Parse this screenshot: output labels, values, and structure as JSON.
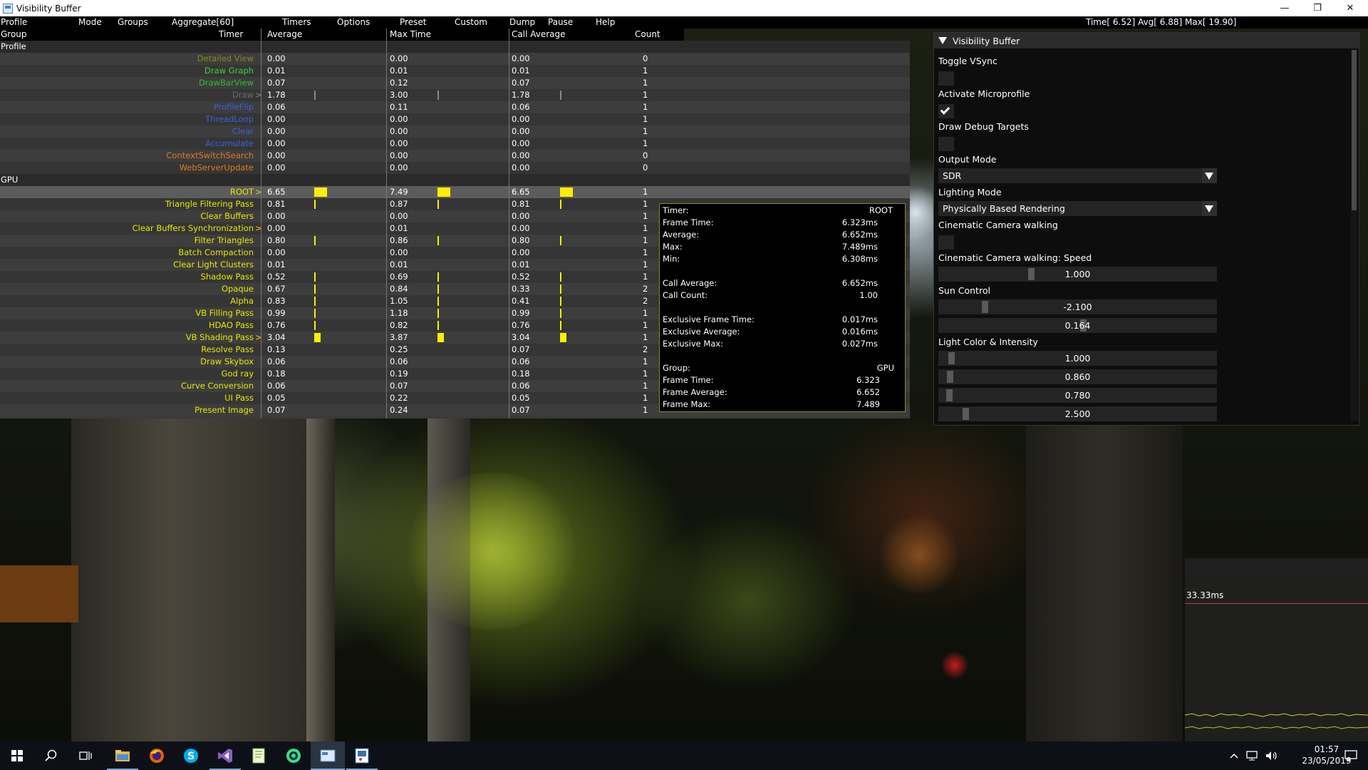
{
  "window": {
    "title": "Visibility Buffer"
  },
  "menu": [
    "Profile",
    "Mode",
    "Groups",
    "Aggregate[60]",
    "Timers",
    "Options",
    "Preset",
    "Custom",
    "Dump",
    "Pause",
    "Help"
  ],
  "stats": "Time[  6.52] Avg[  6.88] Max[ 19.90]",
  "columns": {
    "group": "Group",
    "timer": "Timer",
    "average": "Average",
    "max_time": "Max Time",
    "call_average": "Call Average",
    "count": "Count"
  },
  "sections": {
    "profile": "Profile",
    "gpu": "GPU"
  },
  "profile_rows": [
    {
      "name": "Detailed View",
      "color": "#8a8a1e",
      "avg": "0.00",
      "max": "0.00",
      "call": "0.00",
      "count": "0"
    },
    {
      "name": "Draw Graph",
      "color": "#3ed13e",
      "avg": "0.01",
      "max": "0.01",
      "call": "0.01",
      "count": "1"
    },
    {
      "name": "DrawBarView",
      "color": "#2fbf2f",
      "avg": "0.07",
      "max": "0.12",
      "call": "0.07",
      "count": "1"
    },
    {
      "name": "Draw",
      "color": "#6e6e6e",
      "avg": "1.78",
      "max": "3.00",
      "call": "1.78",
      "count": "1",
      "arrow": true,
      "ticks": "grey"
    },
    {
      "name": "ProfileFlip",
      "color": "#3b5fe0",
      "avg": "0.06",
      "max": "0.11",
      "call": "0.06",
      "count": "1"
    },
    {
      "name": "ThreadLoop",
      "color": "#3b5fe0",
      "avg": "0.00",
      "max": "0.00",
      "call": "0.00",
      "count": "1"
    },
    {
      "name": "Clear",
      "color": "#3b5fe0",
      "avg": "0.00",
      "max": "0.00",
      "call": "0.00",
      "count": "1"
    },
    {
      "name": "Accumulate",
      "color": "#3b5fe0",
      "avg": "0.00",
      "max": "0.00",
      "call": "0.00",
      "count": "1"
    },
    {
      "name": "ContextSwitchSearch",
      "color": "#e07a1e",
      "avg": "0.00",
      "max": "0.00",
      "call": "0.00",
      "count": "0"
    },
    {
      "name": "WebServerUpdate",
      "color": "#e07a1e",
      "avg": "0.00",
      "max": "0.00",
      "call": "0.00",
      "count": "0"
    }
  ],
  "gpu_rows": [
    {
      "name": "ROOT",
      "avg": "6.65",
      "max": "7.49",
      "call": "6.65",
      "count": "1",
      "arrow": true,
      "bar": "big",
      "hl": true
    },
    {
      "name": "Triangle Filtering Pass",
      "avg": "0.81",
      "max": "0.87",
      "call": "0.81",
      "count": "1",
      "ticks": "y"
    },
    {
      "name": "Clear Buffers",
      "avg": "0.00",
      "max": "0.00",
      "call": "0.00",
      "count": "1"
    },
    {
      "name": "Clear Buffers Synchronization",
      "avg": "0.00",
      "max": "0.01",
      "call": "0.00",
      "count": "1",
      "arrow": true
    },
    {
      "name": "Filter Triangles",
      "avg": "0.80",
      "max": "0.86",
      "call": "0.80",
      "count": "1",
      "ticks": "y"
    },
    {
      "name": "Batch Compaction",
      "avg": "0.00",
      "max": "0.00",
      "call": "0.00",
      "count": "1"
    },
    {
      "name": "Clear Light Clusters",
      "avg": "0.01",
      "max": "0.01",
      "call": "0.01",
      "count": "1"
    },
    {
      "name": "Shadow Pass",
      "avg": "0.52",
      "max": "0.69",
      "call": "0.52",
      "count": "1",
      "ticks": "y"
    },
    {
      "name": "Opaque",
      "avg": "0.67",
      "max": "0.84",
      "call": "0.33",
      "count": "2",
      "ticks": "y"
    },
    {
      "name": "Alpha",
      "avg": "0.83",
      "max": "1.05",
      "call": "0.41",
      "count": "2",
      "ticks": "y"
    },
    {
      "name": "VB Filling Pass",
      "avg": "0.99",
      "max": "1.18",
      "call": "0.99",
      "count": "1",
      "ticks": "y"
    },
    {
      "name": "HDAO Pass",
      "avg": "0.76",
      "max": "0.82",
      "call": "0.76",
      "count": "1",
      "ticks": "y"
    },
    {
      "name": "VB Shading Pass",
      "avg": "3.04",
      "max": "3.87",
      "call": "3.04",
      "count": "1",
      "arrow": true,
      "bar": "mid"
    },
    {
      "name": "Resolve Pass",
      "avg": "0.13",
      "max": "0.25",
      "call": "0.07",
      "count": "2"
    },
    {
      "name": "Draw Skybox",
      "avg": "0.06",
      "max": "0.06",
      "call": "0.06",
      "count": "1"
    },
    {
      "name": "God ray",
      "avg": "0.18",
      "max": "0.19",
      "call": "0.18",
      "count": "1"
    },
    {
      "name": "Curve Conversion",
      "avg": "0.06",
      "max": "0.07",
      "call": "0.06",
      "count": "1"
    },
    {
      "name": "UI Pass",
      "avg": "0.05",
      "max": "0.22",
      "call": "0.05",
      "count": "1"
    },
    {
      "name": "Present Image",
      "avg": "0.07",
      "max": "0.24",
      "call": "0.07",
      "count": "1"
    }
  ],
  "tooltip": {
    "timer_label": "Timer:",
    "timer_value": "ROOT",
    "lines": [
      {
        "k": "Frame Time:",
        "v": "6.323ms"
      },
      {
        "k": "Average:",
        "v": "6.652ms"
      },
      {
        "k": "Max:",
        "v": "7.489ms"
      },
      {
        "k": "Min:",
        "v": "6.308ms"
      },
      {
        "k": "Call Average:",
        "v": "6.652ms"
      },
      {
        "k": "Call Count:",
        "v": "1.00"
      },
      {
        "k": "Exclusive Frame Time:",
        "v": "0.017ms"
      },
      {
        "k": "Exclusive Average:",
        "v": "0.016ms"
      },
      {
        "k": "Exclusive Max:",
        "v": "0.027ms"
      },
      {
        "k": "Group:",
        "v": "GPU"
      },
      {
        "k": "Frame Time:",
        "v": "6.323"
      },
      {
        "k": "Frame Average:",
        "v": "6.652"
      },
      {
        "k": "Frame Max:",
        "v": "7.489"
      }
    ]
  },
  "gui": {
    "title": "Visibility Buffer",
    "toggle_vsync": {
      "label": "Toggle VSync",
      "checked": false
    },
    "activate_microprofile": {
      "label": "Activate Microprofile",
      "checked": true
    },
    "draw_debug_targets": {
      "label": "Draw Debug Targets",
      "checked": false
    },
    "output_mode": {
      "label": "Output Mode",
      "value": "SDR"
    },
    "lighting_mode": {
      "label": "Lighting Mode",
      "value": "Physically Based Rendering"
    },
    "cinematic_camera": {
      "label": "Cinematic Camera walking",
      "checked": false
    },
    "camera_speed": {
      "label": "Cinematic Camera walking: Speed",
      "value": "1.000",
      "level": 0.33
    },
    "sun_control": {
      "label": "Sun Control",
      "x": "-2.100",
      "x_level": 0.16,
      "y": "0.164",
      "y_level": 0.52
    },
    "light": {
      "label": "Light Color & Intensity",
      "r": "1.000",
      "g": "0.860",
      "b": "0.780",
      "i": "2.500"
    }
  },
  "graph": {
    "threshold": "33.33ms"
  },
  "taskbar": {
    "time": "01:57",
    "date": "23/05/2019",
    "apps": [
      "start-icon",
      "search-icon",
      "task-view-icon",
      "file-explorer-icon",
      "firefox-icon",
      "skype-icon",
      "visual-studio-icon",
      "notepad-plus-icon",
      "android-studio-icon",
      "visibility-buffer-icon",
      "paint-icon"
    ]
  }
}
